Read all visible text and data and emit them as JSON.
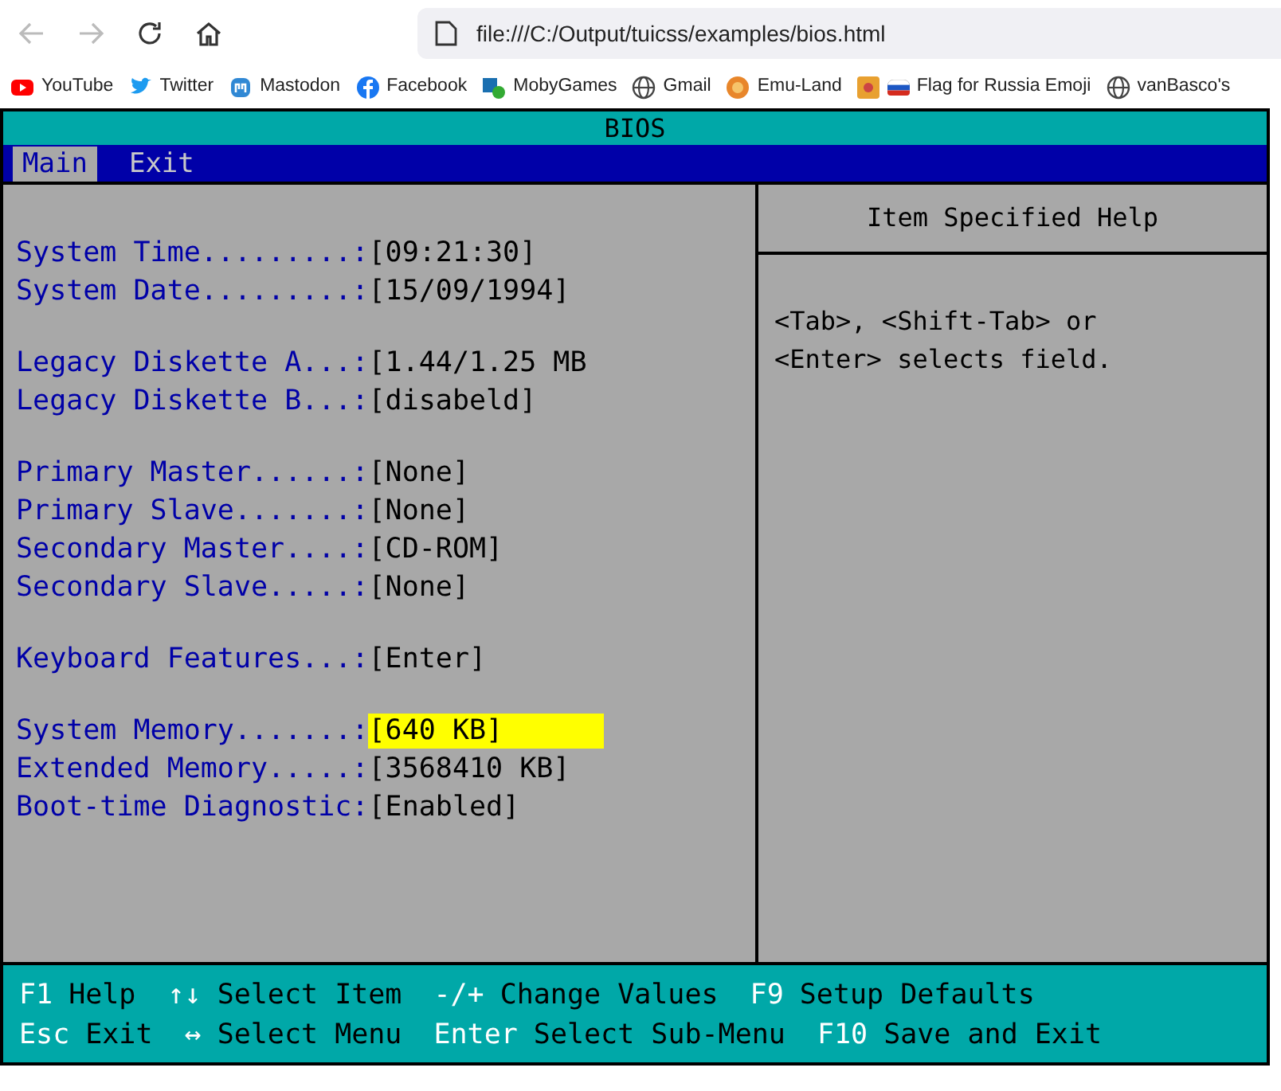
{
  "browser": {
    "address": "file:///C:/Output/tuicss/examples/bios.html",
    "bookmarks": [
      {
        "label": "YouTube",
        "kind": "youtube"
      },
      {
        "label": "Twitter",
        "kind": "twitter"
      },
      {
        "label": "Mastodon",
        "kind": "mastodon"
      },
      {
        "label": "Facebook",
        "kind": "facebook"
      },
      {
        "label": "MobyGames",
        "kind": "moby"
      },
      {
        "label": "Gmail",
        "kind": "globe"
      },
      {
        "label": "Emu-Land",
        "kind": "emu"
      },
      {
        "label": "Flag for Russia Emoji",
        "kind": "flag"
      },
      {
        "label": "vanBasco's",
        "kind": "globe"
      }
    ]
  },
  "bios": {
    "title": "BIOS",
    "menu": [
      {
        "label": "Main",
        "selected": true
      },
      {
        "label": "Exit",
        "selected": false
      }
    ],
    "groups": [
      [
        {
          "label": "System Time.........:",
          "value": "[09:21:30]",
          "selected": false
        },
        {
          "label": "System Date.........:",
          "value": "[15/09/1994]",
          "selected": false
        }
      ],
      [
        {
          "label": "Legacy Diskette A...:",
          "value": "[1.44/1.25 MB",
          "selected": false
        },
        {
          "label": "Legacy Diskette B...:",
          "value": "[disabeld]",
          "selected": false
        }
      ],
      [
        {
          "label": "Primary Master......:",
          "value": "[None]",
          "selected": false
        },
        {
          "label": "Primary Slave.......:",
          "value": "[None]",
          "selected": false
        },
        {
          "label": "Secondary Master....:",
          "value": "[CD-ROM]",
          "selected": false
        },
        {
          "label": "Secondary Slave.....:",
          "value": "[None]",
          "selected": false
        }
      ],
      [
        {
          "label": "Keyboard Features...:",
          "value": "[Enter]",
          "selected": false
        }
      ],
      [
        {
          "label": "System Memory.......:",
          "value": "[640 KB]",
          "selected": true
        },
        {
          "label": "Extended Memory.....:",
          "value": "[3568410 KB]",
          "selected": false
        },
        {
          "label": "Boot-time Diagnostic:",
          "value": "[Enabled]",
          "selected": false
        }
      ]
    ],
    "help": {
      "title": "Item Specified Help",
      "text": "<Tab>, <Shift-Tab> or <Enter> selects field."
    },
    "footer": [
      [
        {
          "key": "F1",
          "label": "Help"
        },
        {
          "key": "↑↓",
          "label": "Select Item"
        },
        {
          "key": "-/+",
          "label": "Change Values"
        },
        {
          "key": "F9",
          "label": "Setup Defaults"
        }
      ],
      [
        {
          "key": "Esc",
          "label": "Exit"
        },
        {
          "key": "↔",
          "label": "Select Menu"
        },
        {
          "key": "Enter",
          "label": "Select Sub-Menu"
        },
        {
          "key": "F10",
          "label": "Save and Exit"
        }
      ]
    ]
  }
}
